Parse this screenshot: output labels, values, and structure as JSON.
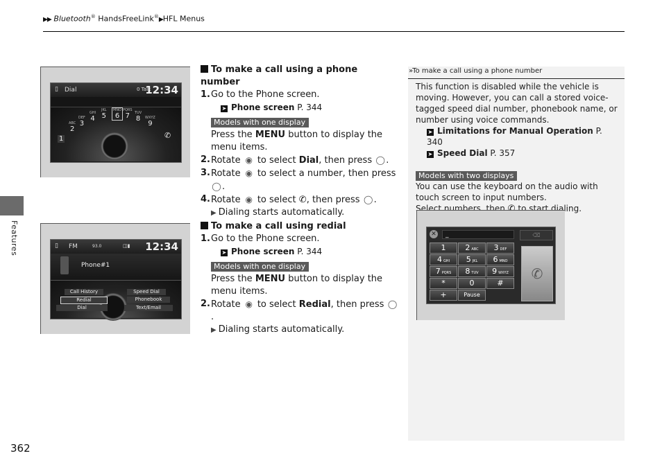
{
  "breadcrumb": {
    "arrows": "▶▶",
    "part1": "Bluetooth",
    "reg1": "®",
    "part2": " HandsFreeLink",
    "reg2": "®",
    "sep": "▶",
    "part3": "HFL Menus"
  },
  "side_tab": {
    "label": "Features"
  },
  "page_number": "362",
  "figures": {
    "dial_screen": {
      "title": "Dial",
      "status": "0 Talk",
      "clock": "12:34",
      "digits": [
        {
          "d": "1",
          "l": ""
        },
        {
          "d": "2",
          "l": "ABC"
        },
        {
          "d": "3",
          "l": "DEF"
        },
        {
          "d": "4",
          "l": "GHI"
        },
        {
          "d": "5",
          "l": "JKL"
        },
        {
          "d": "6",
          "l": "MNO"
        },
        {
          "d": "7",
          "l": "PQRS"
        },
        {
          "d": "8",
          "l": "TUV"
        },
        {
          "d": "9",
          "l": "WXYZ"
        }
      ]
    },
    "phone_menu_screen": {
      "source": "FM",
      "freq": "93.0",
      "clock": "12:34",
      "phone_name": "Phone#1",
      "menu_items": [
        "Call History",
        "Speed Dial",
        "Redial",
        "Phonebook",
        "Dial",
        "Text/Email"
      ],
      "selected": "Redial"
    },
    "keypad_screen": {
      "input": "_",
      "keys": [
        {
          "d": "1",
          "l": ""
        },
        {
          "d": "2",
          "l": "ABC"
        },
        {
          "d": "3",
          "l": "DEF"
        },
        {
          "d": "4",
          "l": "GHI"
        },
        {
          "d": "5",
          "l": "JKL"
        },
        {
          "d": "6",
          "l": "MNO"
        },
        {
          "d": "7",
          "l": "PQRS"
        },
        {
          "d": "8",
          "l": "TUV"
        },
        {
          "d": "9",
          "l": "WXYZ"
        },
        {
          "d": "*",
          "l": ""
        },
        {
          "d": "0",
          "l": ""
        },
        {
          "d": "#",
          "l": ""
        },
        {
          "d": "+",
          "l": ""
        },
        {
          "d": "Pause",
          "l": ""
        }
      ]
    }
  },
  "section1": {
    "heading": "To make a call using a phone number",
    "step1": "Go to the Phone screen.",
    "ref1_bold": "Phone screen",
    "ref1_page": " P. 344",
    "badge": "Models with one display",
    "press_pre": "Press the ",
    "press_bold": "MENU",
    "press_post": " button to display the menu items.",
    "step2_pre": "Rotate ",
    "step2_mid": " to select ",
    "step2_bold": "Dial",
    "step2_post": ", then press ",
    "step3_pre": "Rotate ",
    "step3_post": " to select a number, then press ",
    "step4_pre": "Rotate ",
    "step4_mid": " to select ",
    "step4_post": ", then press ",
    "result": "Dialing starts automatically."
  },
  "section2": {
    "heading": "To make a call using redial",
    "step1": "Go to the Phone screen.",
    "ref1_bold": "Phone screen",
    "ref1_page": " P. 344",
    "badge": "Models with one display",
    "press_pre": "Press the ",
    "press_bold": "MENU",
    "press_post": " button to display the menu items.",
    "step2_pre": "Rotate ",
    "step2_mid": " to select ",
    "step2_bold": "Redial",
    "step2_post": ", then press ",
    "result": "Dialing starts automatically."
  },
  "note": {
    "heading": "To make a call using a phone number",
    "body": "This function is disabled while the vehicle is moving. However, you can call a stored voice-tagged speed dial number, phonebook name, or number using voice commands.",
    "ref1_bold": "Limitations for Manual Operation",
    "ref1_page": " P. 340",
    "ref2_bold": "Speed Dial",
    "ref2_page": " P. 357",
    "badge": "Models with two displays",
    "body2": "You can use the keyboard on the audio with touch screen to input numbers.",
    "body3_pre": "Select numbers, then ",
    "body3_post": " to start dialing."
  },
  "icons": {
    "knob": "interface-dial-icon",
    "press": "selector-press-icon",
    "phone": "handset-icon",
    "ref": "reference-arrow-icon"
  },
  "colors": {
    "badge_bg": "#5a5a5a",
    "note_bg": "#f2f2f2",
    "figure_bg": "#d3d3d3",
    "side_tab": "#6b6b6b"
  }
}
